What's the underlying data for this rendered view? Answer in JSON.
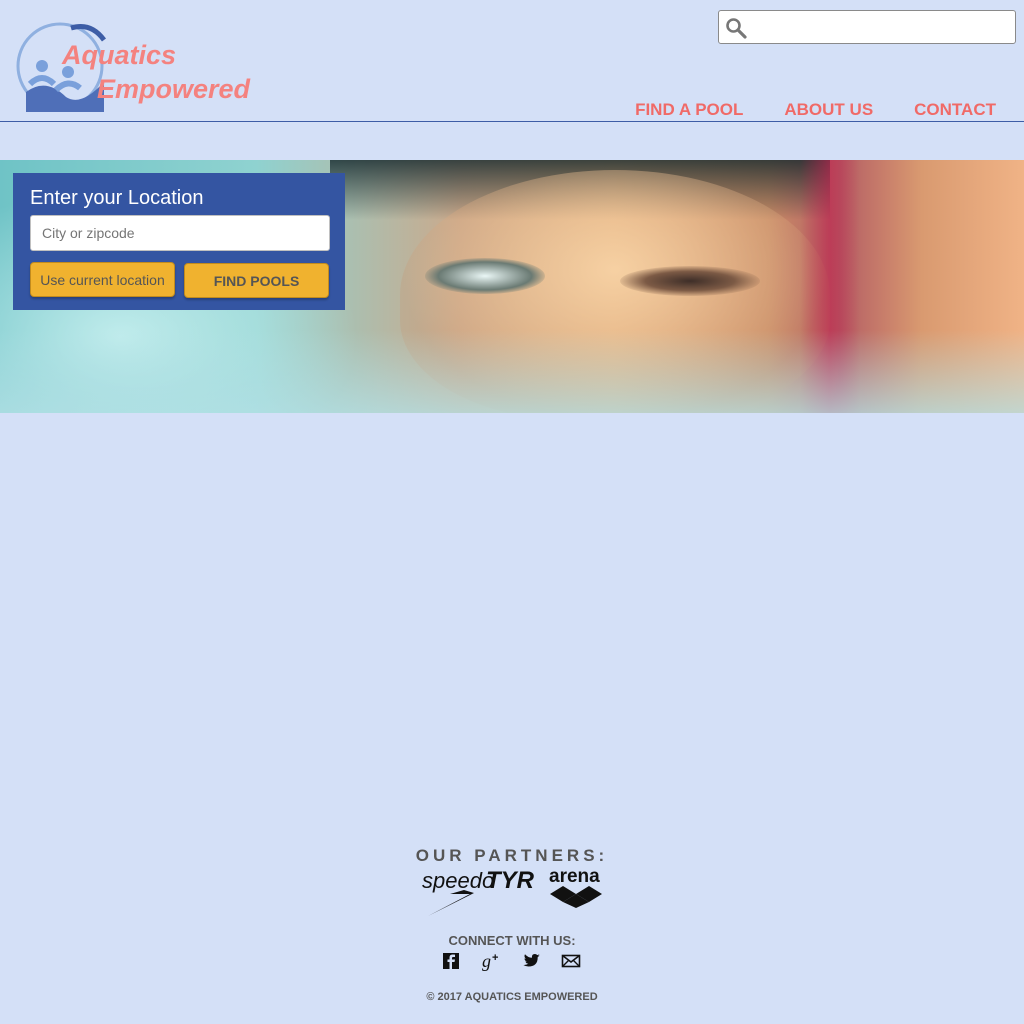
{
  "brand": {
    "line1": "Aquatics",
    "line2": "Empowered",
    "color": "#f4827f"
  },
  "search": {
    "placeholder": "",
    "icon": "search-icon"
  },
  "nav": {
    "items": [
      {
        "label": "FIND A POOL"
      },
      {
        "label": "ABOUT US"
      },
      {
        "label": "CONTACT"
      }
    ],
    "color": "#f06a67"
  },
  "location": {
    "title": "Enter your Location",
    "placeholder": "City or zipcode",
    "use_current": "Use current location",
    "find": "FIND POOLS"
  },
  "partners": {
    "title": "OUR PARTNERS:",
    "logos": [
      "speedo",
      "TYR",
      "arena"
    ]
  },
  "connect": {
    "title": "CONNECT WITH US:",
    "icons": [
      "facebook-icon",
      "google-plus-icon",
      "twitter-icon",
      "email-icon"
    ]
  },
  "footer": {
    "copyright": "© 2017 AQUATICS EMPOWERED"
  },
  "colors": {
    "background": "#d4e0f7",
    "panel": "#3455a2",
    "button": "#f0b22f"
  }
}
